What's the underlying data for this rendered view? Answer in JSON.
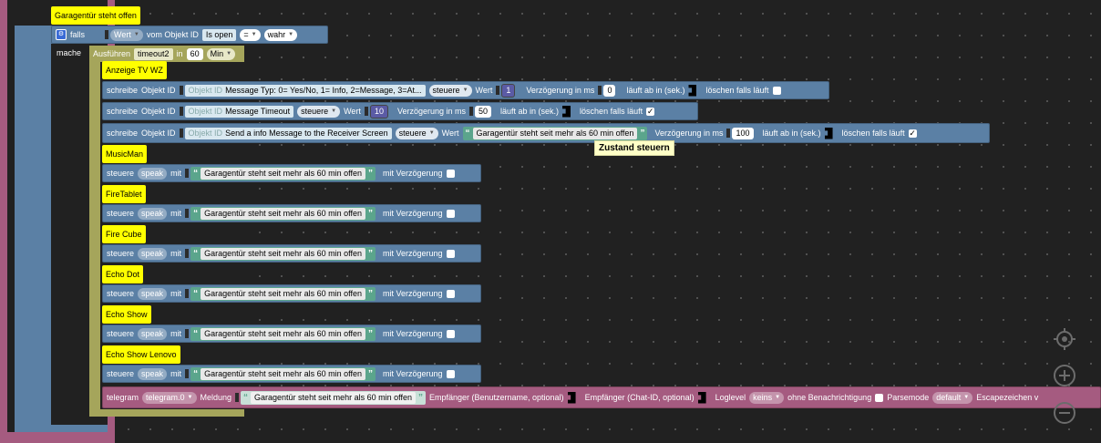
{
  "header_comment": "Garagentür steht offen",
  "if_block": {
    "falls": "falls",
    "wert": "Wert",
    "vom_objekt": "vom Objekt ID",
    "object": "Is open",
    "op": "=",
    "value": "wahr",
    "mache": "mache"
  },
  "timeout_block": {
    "ausfuehren": "Ausführen",
    "name": "timeout2",
    "in": "in",
    "amount": "60",
    "unit": "Min"
  },
  "comments": {
    "anzeige": "Anzeige TV WZ",
    "musicman": "MusicMan",
    "firetablet": "FireTablet",
    "firecube": "Fire Cube",
    "echodot": "Echo Dot",
    "echoshow": "Echo Show",
    "echoshowlenovo": "Echo Show Lenovo"
  },
  "write_rows": [
    {
      "schreibe": "schreibe",
      "objekt": "Objekt ID",
      "ghost": "Objekt ID",
      "target": "Message Typ: 0= Yes/No, 1= Info, 2=Message, 3=At...",
      "steuere": "steuere",
      "wert": "Wert",
      "value": "1",
      "delay_label": "Verzögerung in ms",
      "delay": "0",
      "expires": "läuft ab in (sek.)",
      "clear": "löschen falls läuft",
      "checked": false
    },
    {
      "schreibe": "schreibe",
      "objekt": "Objekt ID",
      "ghost": "Objekt ID",
      "target": "Message Timeout",
      "steuere": "steuere",
      "wert": "Wert",
      "value": "10",
      "delay_label": "Verzögerung in ms",
      "delay": "50",
      "expires": "läuft ab in (sek.)",
      "clear": "löschen falls läuft",
      "checked": true
    },
    {
      "schreibe": "schreibe",
      "objekt": "Objekt ID",
      "ghost": "Objekt ID",
      "target": "Send a info Message to the Receiver Screen",
      "steuere": "steuere",
      "wert": "Wert",
      "value": "Garagentür steht seit mehr als 60 min offen",
      "delay_label": "Verzögerung in ms",
      "delay": "100",
      "expires": "läuft ab in (sek.)",
      "clear": "löschen falls läuft",
      "checked": true
    }
  ],
  "tooltip": "Zustand steuern",
  "speak": {
    "steuere": "steuere",
    "mode": "speak",
    "mit": "mit",
    "message": "Garagentür steht seit mehr als 60 min offen",
    "delay": "mit Verzögerung"
  },
  "telegram": {
    "label": "telegram",
    "instance": "telegram.0",
    "meldung": "Meldung",
    "message": "Garagentür steht seit mehr als 60 min offen",
    "recipient_user": "Empfänger (Benutzername, optional)",
    "recipient_chat": "Empfänger (Chat-ID, optional)",
    "loglevel": "Loglevel",
    "loglevel_value": "keins",
    "silent": "ohne Benachrichtigung",
    "parsemode": "Parsemode",
    "parsemode_value": "default",
    "escape": "Escapezeichen v"
  },
  "colors": {
    "workspace": "#212121",
    "logic": "#5b80a5",
    "text": "#5ba58c",
    "comment": "#ffff00",
    "timeout": "#a5a55b",
    "telegram": "#a55b80"
  }
}
